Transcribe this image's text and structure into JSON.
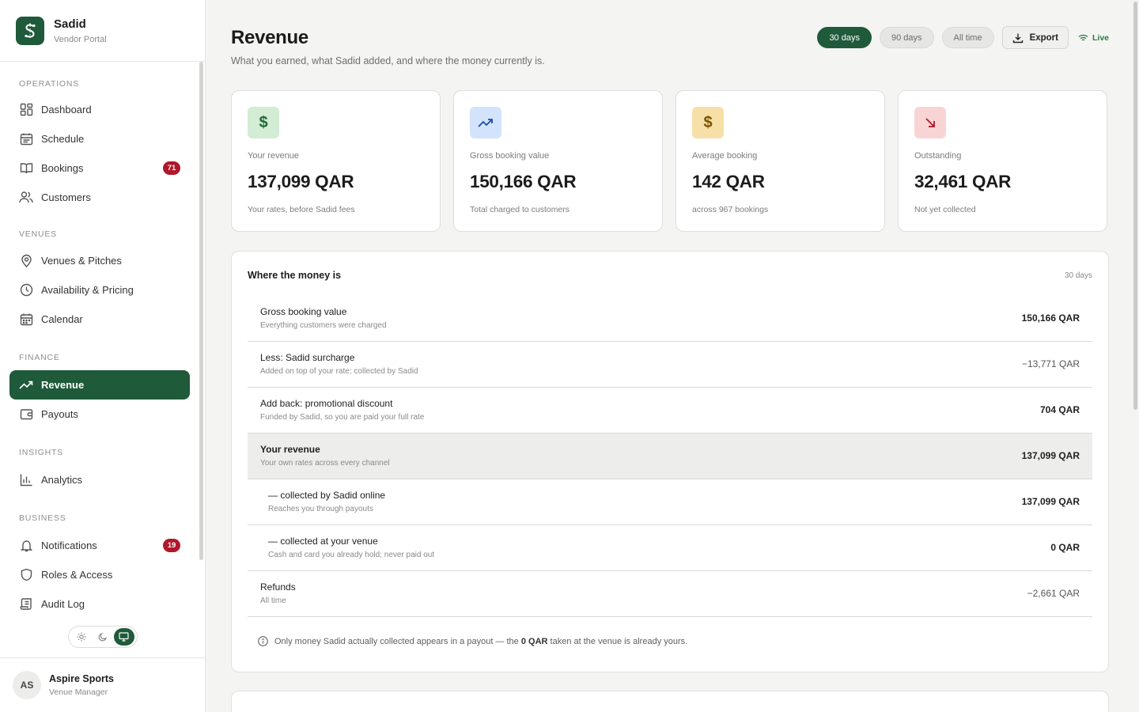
{
  "brand": {
    "name": "Sadid",
    "subtitle": "Vendor Portal"
  },
  "sections": {
    "operations": "OPERATIONS",
    "venues": "VENUES",
    "finance": "FINANCE",
    "insights": "INSIGHTS",
    "business": "BUSINESS"
  },
  "nav": {
    "dashboard": "Dashboard",
    "schedule": "Schedule",
    "bookings": "Bookings",
    "bookings_badge": "71",
    "customers": "Customers",
    "venues_pitches": "Venues & Pitches",
    "availability": "Availability & Pricing",
    "calendar": "Calendar",
    "revenue": "Revenue",
    "payouts": "Payouts",
    "analytics": "Analytics",
    "notifications": "Notifications",
    "notifications_badge": "19",
    "roles": "Roles & Access",
    "audit": "Audit Log"
  },
  "user": {
    "initials": "AS",
    "name": "Aspire Sports",
    "role": "Venue Manager"
  },
  "header": {
    "title": "Revenue",
    "subtitle": "What you earned, what Sadid added, and where the money currently is.",
    "ranges": [
      "30 days",
      "90 days",
      "All time"
    ],
    "export_label": "Export",
    "live_label": "Live"
  },
  "cards": [
    {
      "icon": "dollar-icon",
      "label": "Your revenue",
      "value": "137,099 QAR",
      "note": "Your rates, before Sadid fees",
      "bg": "#d3ecd4",
      "fg": "#1f6b35"
    },
    {
      "icon": "trending-up-icon",
      "label": "Gross booking value",
      "value": "150,166 QAR",
      "note": "Total charged to customers",
      "bg": "#d3e3fb",
      "fg": "#1d4fa6"
    },
    {
      "icon": "dollar-icon",
      "label": "Average booking",
      "value": "142 QAR",
      "note": "across 967 bookings",
      "bg": "#f6e0a8",
      "fg": "#7a5200"
    },
    {
      "icon": "arrow-down-right-icon",
      "label": "Outstanding",
      "value": "32,461 QAR",
      "note": "Not yet collected",
      "bg": "#f9d4d4",
      "fg": "#b0172a"
    }
  ],
  "money": {
    "title": "Where the money is",
    "range": "30 days",
    "rows": [
      {
        "label": "Gross booking value",
        "sub": "Everything customers were charged",
        "value": "150,166 QAR"
      },
      {
        "label": "Less: Sadid surcharge",
        "sub": "Added on top of your rate; collected by Sadid",
        "value": "−13,771 QAR"
      },
      {
        "label": "Add back: promotional discount",
        "sub": "Funded by Sadid, so you are paid your full rate",
        "value": "704 QAR"
      },
      {
        "label": "Your revenue",
        "sub": "Your own rates across every channel",
        "value": "137,099 QAR"
      },
      {
        "label": "— collected by Sadid online",
        "sub": "Reaches you through payouts",
        "value": "137,099 QAR"
      },
      {
        "label": "— collected at your venue",
        "sub": "Cash and card you already hold; never paid out",
        "value": "0 QAR"
      },
      {
        "label": "Refunds",
        "sub": "All time",
        "value": "−2,661 QAR"
      }
    ],
    "note_before": "Only money Sadid actually collected appears in a payout — the",
    "note_amount": "0 QAR",
    "note_after": "taken at the venue is already yours."
  },
  "colors": {
    "brand": "#1f5a3a",
    "badge": "#b0172a",
    "live": "#2d7a3e"
  }
}
